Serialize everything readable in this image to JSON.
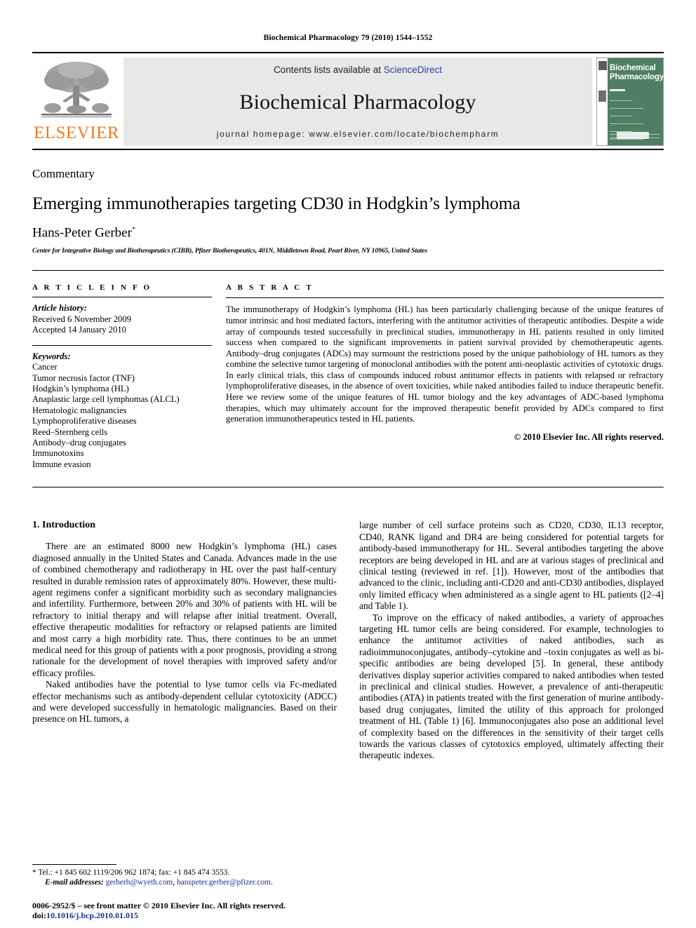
{
  "running_head": "Biochemical Pharmacology 79 (2010) 1544–1552",
  "masthead": {
    "contents_prefix": "Contents lists available at ",
    "sciencedirect": "ScienceDirect",
    "journal_title": "Biochemical Pharmacology",
    "homepage": "journal homepage: www.elsevier.com/locate/biochempharm",
    "publisher_logo_text": "ELSEVIER",
    "cover_title_line1": "Biochemical",
    "cover_title_line2": "Pharmacology",
    "accent_orange": "#ef7d22",
    "accent_link": "#2b3fa0",
    "cover_green": "#4f7f62"
  },
  "article": {
    "type": "Commentary",
    "title": "Emerging immunotherapies targeting CD30 in Hodgkin’s lymphoma",
    "author": "Hans-Peter Gerber",
    "author_marker": "*",
    "affiliation": "Center for Integrative Biology and Biotherapeutics (CIBB), Pfizer Biotherapeutics, 401N, Middletown Road, Pearl River, NY 10965, United States"
  },
  "article_info": {
    "heading": "A R T I C L E   I N F O",
    "history_label": "Article history:",
    "received": "Received 6 November 2009",
    "accepted": "Accepted 14 January 2010",
    "keywords_label": "Keywords:",
    "keywords": [
      "Cancer",
      "Tumor necrosis factor (TNF)",
      "Hodgkin’s lymphoma (HL)",
      "Anaplastic large cell lymphomas (ALCL)",
      "Hematologic malignancies",
      "Lymphoproliferative diseases",
      "Reed–Sternberg cells",
      "Antibody–drug conjugates",
      "Immunotoxins",
      "Immune evasion"
    ]
  },
  "abstract": {
    "heading": "A B S T R A C T",
    "text": "The immunotherapy of Hodgkin’s lymphoma (HL) has been particularly challenging because of the unique features of tumor intrinsic and host mediated factors, interfering with the antitumor activities of therapeutic antibodies. Despite a wide array of compounds tested successfully in preclinical studies, immunotherapy in HL patients resulted in only limited success when compared to the significant improvements in patient survival provided by chemotherapeutic agents. Antibody–drug conjugates (ADCs) may surmount the restrictions posed by the unique pathobiology of HL tumors as they combine the selective tumor targeting of monoclonal antibodies with the potent anti-neoplastic activities of cytotoxic drugs. In early clinical trials, this class of compounds induced robust antitumor effects in patients with relapsed or refractory lymphoproliferative diseases, in the absence of overt toxicities, while naked antibodies failed to induce therapeutic benefit. Here we review some of the unique features of HL tumor biology and the key advantages of ADC-based lymphoma therapies, which may ultimately account for the improved therapeutic benefit provided by ADCs compared to first generation immunotherapeutics tested in HL patients.",
    "rights": "© 2010 Elsevier Inc. All rights reserved."
  },
  "body": {
    "section_heading": "1. Introduction",
    "left_paragraphs": [
      "There are an estimated 8000 new Hodgkin’s lymphoma (HL) cases diagnosed annually in the United States and Canada. Advances made in the use of combined chemotherapy and radiotherapy in HL over the past half-century resulted in durable remission rates of approximately 80%. However, these multi-agent regimens confer a significant morbidity such as secondary malignancies and infertility. Furthermore, between 20% and 30% of patients with HL will be refractory to initial therapy and will relapse after initial treatment. Overall, effective therapeutic modalities for refractory or relapsed patients are limited and most carry a high morbidity rate. Thus, there continues to be an unmet medical need for this group of patients with a poor prognosis, providing a strong rationale for the development of novel therapies with improved safety and/or efficacy profiles.",
      "Naked antibodies have the potential to lyse tumor cells via Fc-mediated effector mechanisms such as antibody-dependent cellular cytotoxicity (ADCC) and were developed successfully in hematologic malignancies. Based on their presence on HL tumors, a"
    ],
    "right_paragraphs": [
      "large number of cell surface proteins such as CD20, CD30, IL13 receptor, CD40, RANK ligand and DR4 are being considered for potential targets for antibody-based immunotherapy for HL. Several antibodies targeting the above receptors are being developed in HL and are at various stages of preclinical and clinical testing (reviewed in ref. [1]). However, most of the antibodies that advanced to the clinic, including anti-CD20 and anti-CD30 antibodies, displayed only limited efficacy when administered as a single agent to HL patients ([2–4] and Table 1).",
      "To improve on the efficacy of naked antibodies, a variety of approaches targeting HL tumor cells are being considered. For example, technologies to enhance the antitumor activities of naked antibodies, such as radioimmunoconjugates, antibody–cytokine and –toxin conjugates as well as bi-specific antibodies are being developed [5]. In general, these antibody derivatives display superior activities compared to naked antibodies when tested in preclinical and clinical studies. However, a prevalence of anti-therapeutic antibodies (ATA) in patients treated with the first generation of murine antibody-based drug conjugates, limited the utility of this approach for prolonged treatment of HL (Table 1) [6]. Immunoconjugates also pose an additional level of complexity based on the differences in the sensitivity of their target cells towards the various classes of cytotoxics employed, ultimately affecting their therapeutic indexes."
    ]
  },
  "footnotes": {
    "tel_line": "* Tel.: +1 845 602 1119/206 962 1874; fax: +1 845 474 3553.",
    "email_label": "E-mail addresses:",
    "email_1": "gerberh@wyeth.com",
    "email_2": "hanspeter.gerber@pfizer.com",
    "issn_line": "0006-2952/$ – see front matter © 2010 Elsevier Inc. All rights reserved.",
    "doi_label": "doi:",
    "doi_value": "10.1016/j.bcp.2010.01.015"
  }
}
